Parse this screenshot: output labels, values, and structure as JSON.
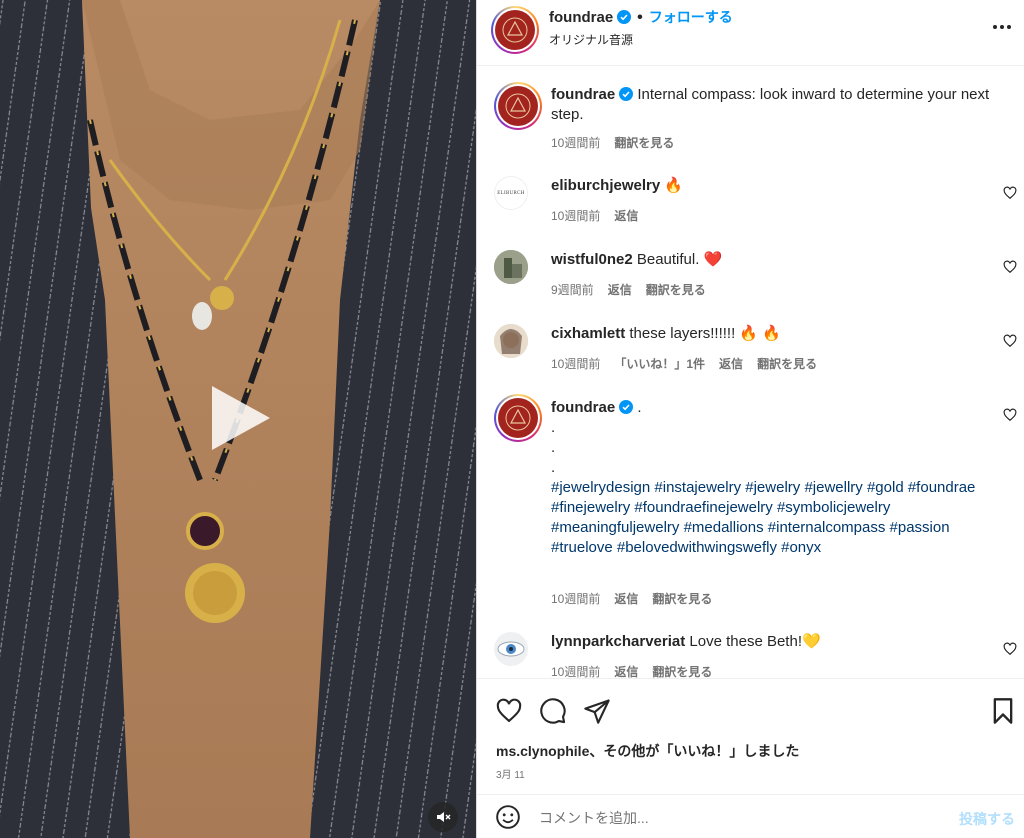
{
  "header": {
    "username": "foundrae",
    "separator": "•",
    "follow_label": "フォローする",
    "audio_label": "オリジナル音源"
  },
  "caption": {
    "username": "foundrae",
    "text": "Internal compass: look inward to determine your next step.",
    "time": "10週間前",
    "translate": "翻訳を見る"
  },
  "comments": [
    {
      "username": "eliburchjewelry",
      "text": "🔥",
      "time": "10週間前",
      "actions": [
        "返信"
      ],
      "avatar_text": "ELIBURCH"
    },
    {
      "username": "wistful0ne2",
      "text": "Beautiful. ❤️",
      "time": "9週間前",
      "actions": [
        "返信",
        "翻訳を見る"
      ]
    },
    {
      "username": "cixhamlett",
      "text": "these layers!!!!!! 🔥 🔥",
      "time": "10週間前",
      "actions": [
        "「いいね！」1件",
        "返信",
        "翻訳を見る"
      ]
    },
    {
      "username": "foundrae",
      "text_lines": [
        ".",
        ".",
        "."
      ],
      "hashtags": "#jewelrydesign #instajewelry #jewelry #jewellry #gold #foundrae #finejewelry #foundraefinejewelry #symbolicjewelry #meaningfuljewelry #medallions #internalcompass #passion #truelove #belovedwithwingswefly #onyx",
      "time": "10週間前",
      "actions": [
        "返信",
        "翻訳を見る"
      ]
    },
    {
      "username": "lynnparkcharveriat",
      "text": "Love these Beth!💛",
      "time": "10週間前",
      "actions": [
        "返信",
        "翻訳を見る"
      ]
    }
  ],
  "likes": {
    "name": "ms.clynophile",
    "suffix": "、その他が「いいね！」しました"
  },
  "date": "3月 11",
  "add_comment": {
    "placeholder": "コメントを追加...",
    "post_label": "投稿する"
  },
  "colors": {
    "accent": "#0095f6",
    "hashtag": "#00376b",
    "muted": "#737373",
    "brand_seal": "#a3241f"
  }
}
